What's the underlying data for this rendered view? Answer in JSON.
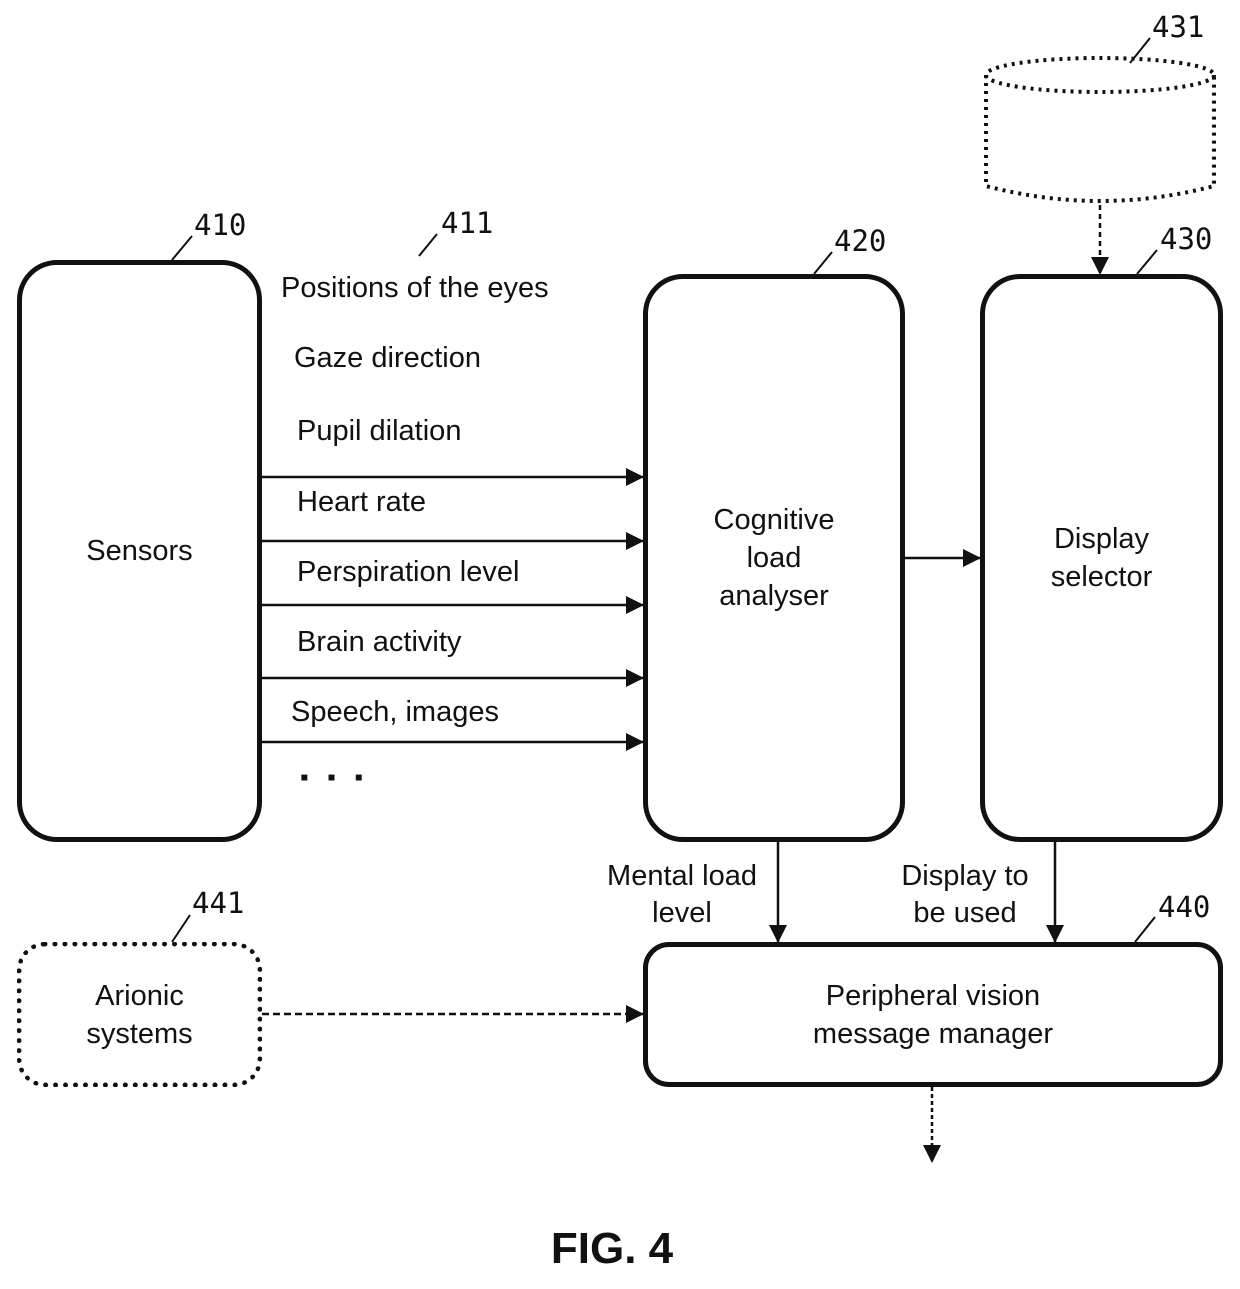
{
  "figure": {
    "caption": "FIG. 4"
  },
  "blocks": {
    "sensors": {
      "ref": "410",
      "label": "Sensors"
    },
    "signals": {
      "ref": "411"
    },
    "analyser": {
      "ref": "420",
      "label": "Cognitive\nload\nanalyser"
    },
    "selector": {
      "ref": "430",
      "label": "Display\nselector"
    },
    "database": {
      "ref": "431"
    },
    "manager": {
      "ref": "440",
      "label": "Peripheral vision\nmessage manager"
    },
    "avionic": {
      "ref": "441",
      "label": "Arionic\nsystems"
    }
  },
  "signals": [
    "Positions of the eyes",
    "Gaze direction",
    "Pupil dilation",
    "Heart rate",
    "Perspiration level",
    "Brain activity",
    "Speech, images"
  ],
  "ellipsis": "▪ ▪ ▪",
  "edges": {
    "mental_load": "Mental load\nlevel",
    "display_used": "Display to\nbe used"
  }
}
